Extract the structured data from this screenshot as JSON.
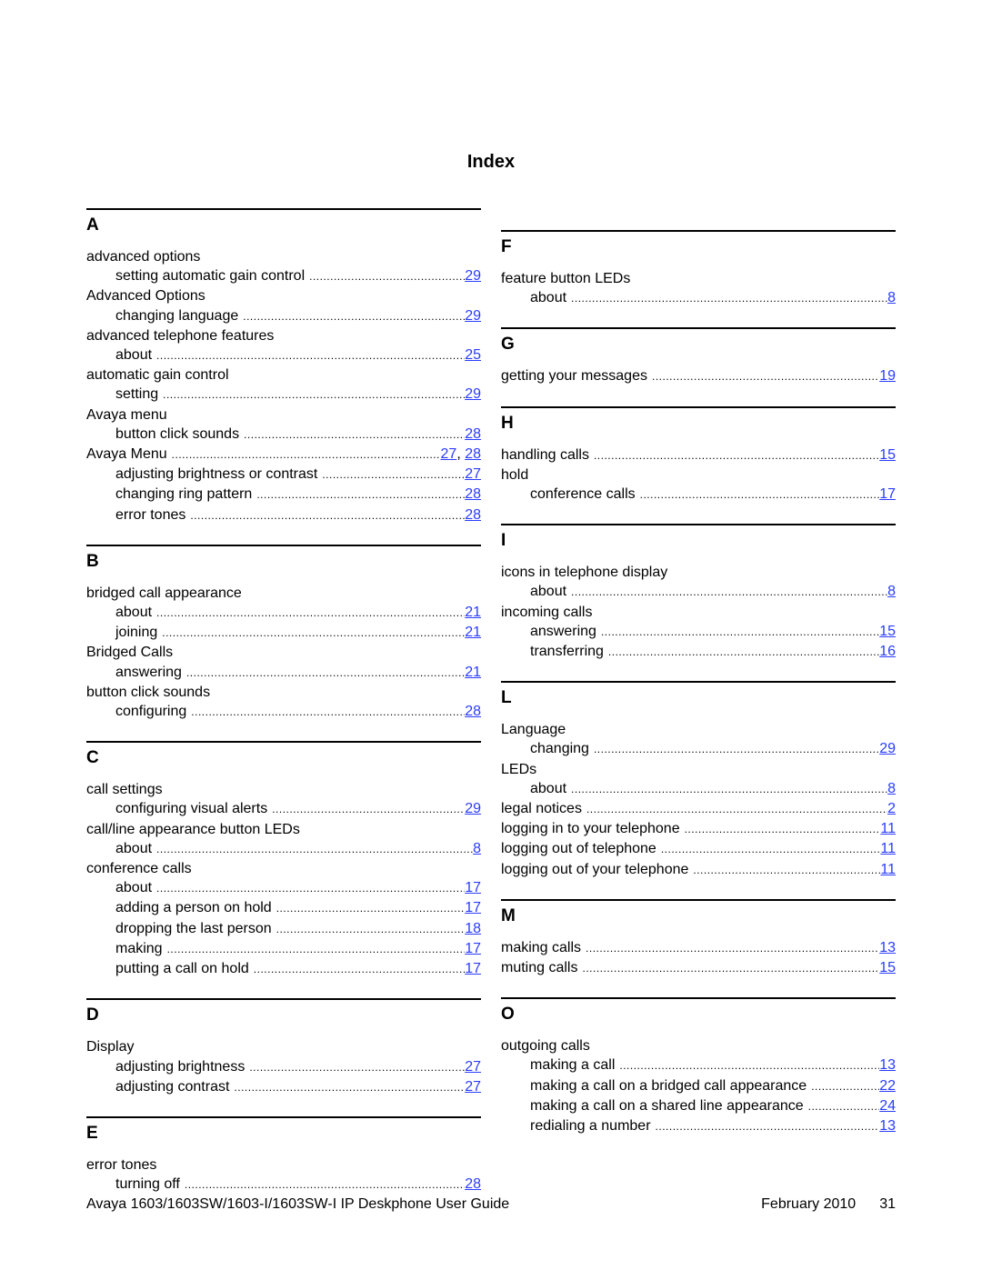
{
  "page_title": "Index",
  "columns": [
    [
      {
        "letter": "A",
        "entries": [
          {
            "term": "advanced options",
            "level": 0,
            "pages": []
          },
          {
            "term": "setting automatic gain control",
            "level": 1,
            "pages": [
              "29"
            ]
          },
          {
            "term": "Advanced Options",
            "level": 0,
            "pages": []
          },
          {
            "term": "changing language",
            "level": 1,
            "pages": [
              "29"
            ]
          },
          {
            "term": "advanced telephone features",
            "level": 0,
            "pages": []
          },
          {
            "term": "about",
            "level": 1,
            "pages": [
              "25"
            ]
          },
          {
            "term": "automatic gain control",
            "level": 0,
            "pages": []
          },
          {
            "term": "setting",
            "level": 1,
            "pages": [
              "29"
            ]
          },
          {
            "term": "Avaya menu",
            "level": 0,
            "pages": []
          },
          {
            "term": "button click sounds",
            "level": 1,
            "pages": [
              "28"
            ]
          },
          {
            "term": "Avaya Menu",
            "level": 0,
            "pages": [
              "27",
              "28"
            ]
          },
          {
            "term": "adjusting brightness or contrast",
            "level": 1,
            "pages": [
              "27"
            ]
          },
          {
            "term": "changing ring pattern",
            "level": 1,
            "pages": [
              "28"
            ]
          },
          {
            "term": "error tones",
            "level": 1,
            "pages": [
              "28"
            ]
          }
        ]
      },
      {
        "letter": "B",
        "entries": [
          {
            "term": "bridged call appearance",
            "level": 0,
            "pages": []
          },
          {
            "term": "about",
            "level": 1,
            "pages": [
              "21"
            ]
          },
          {
            "term": "joining",
            "level": 1,
            "pages": [
              "21"
            ]
          },
          {
            "term": "Bridged Calls",
            "level": 0,
            "pages": []
          },
          {
            "term": "answering",
            "level": 1,
            "pages": [
              "21"
            ]
          },
          {
            "term": "button click sounds",
            "level": 0,
            "pages": []
          },
          {
            "term": "configuring",
            "level": 1,
            "pages": [
              "28"
            ]
          }
        ]
      },
      {
        "letter": "C",
        "entries": [
          {
            "term": "call settings",
            "level": 0,
            "pages": []
          },
          {
            "term": "configuring visual alerts",
            "level": 1,
            "pages": [
              "29"
            ]
          },
          {
            "term": "call/line appearance button LEDs",
            "level": 0,
            "pages": []
          },
          {
            "term": "about",
            "level": 1,
            "pages": [
              "8"
            ]
          },
          {
            "term": "conference calls",
            "level": 0,
            "pages": []
          },
          {
            "term": "about",
            "level": 1,
            "pages": [
              "17"
            ]
          },
          {
            "term": "adding a person on hold",
            "level": 1,
            "pages": [
              "17"
            ]
          },
          {
            "term": "dropping the last person",
            "level": 1,
            "pages": [
              "18"
            ]
          },
          {
            "term": "making",
            "level": 1,
            "pages": [
              "17"
            ]
          },
          {
            "term": "putting a call on hold",
            "level": 1,
            "pages": [
              "17"
            ]
          }
        ]
      },
      {
        "letter": "D",
        "entries": [
          {
            "term": "Display",
            "level": 0,
            "pages": []
          },
          {
            "term": "adjusting brightness",
            "level": 1,
            "pages": [
              "27"
            ]
          },
          {
            "term": "adjusting contrast",
            "level": 1,
            "pages": [
              "27"
            ]
          }
        ]
      },
      {
        "letter": "E",
        "entries": [
          {
            "term": "error tones",
            "level": 0,
            "pages": []
          },
          {
            "term": "turning off",
            "level": 1,
            "pages": [
              "28"
            ]
          }
        ]
      }
    ],
    [
      {
        "letter": "F",
        "entries": [
          {
            "term": "feature button LEDs",
            "level": 0,
            "pages": []
          },
          {
            "term": "about",
            "level": 1,
            "pages": [
              "8"
            ]
          }
        ]
      },
      {
        "letter": "G",
        "entries": [
          {
            "term": "getting your messages",
            "level": 0,
            "pages": [
              "19"
            ]
          }
        ]
      },
      {
        "letter": "H",
        "entries": [
          {
            "term": "handling calls",
            "level": 0,
            "pages": [
              "15"
            ]
          },
          {
            "term": "hold",
            "level": 0,
            "pages": []
          },
          {
            "term": "conference calls",
            "level": 1,
            "pages": [
              "17"
            ]
          }
        ]
      },
      {
        "letter": "I",
        "entries": [
          {
            "term": "icons in telephone display",
            "level": 0,
            "pages": []
          },
          {
            "term": "about",
            "level": 1,
            "pages": [
              "8"
            ]
          },
          {
            "term": "incoming calls",
            "level": 0,
            "pages": []
          },
          {
            "term": "answering",
            "level": 1,
            "pages": [
              "15"
            ]
          },
          {
            "term": "transferring",
            "level": 1,
            "pages": [
              "16"
            ]
          }
        ]
      },
      {
        "letter": "L",
        "entries": [
          {
            "term": "Language",
            "level": 0,
            "pages": []
          },
          {
            "term": "changing",
            "level": 1,
            "pages": [
              "29"
            ]
          },
          {
            "term": "LEDs",
            "level": 0,
            "pages": []
          },
          {
            "term": "about",
            "level": 1,
            "pages": [
              "8"
            ]
          },
          {
            "term": "legal notices",
            "level": 0,
            "pages": [
              "2"
            ]
          },
          {
            "term": "logging in to your telephone",
            "level": 0,
            "pages": [
              "11"
            ]
          },
          {
            "term": "logging out of telephone",
            "level": 0,
            "pages": [
              "11"
            ]
          },
          {
            "term": "logging out of your telephone",
            "level": 0,
            "pages": [
              "11"
            ]
          }
        ]
      },
      {
        "letter": "M",
        "entries": [
          {
            "term": "making calls",
            "level": 0,
            "pages": [
              "13"
            ]
          },
          {
            "term": "muting calls",
            "level": 0,
            "pages": [
              "15"
            ]
          }
        ]
      },
      {
        "letter": "O",
        "entries": [
          {
            "term": "outgoing calls",
            "level": 0,
            "pages": []
          },
          {
            "term": "making a call",
            "level": 1,
            "pages": [
              "13"
            ]
          },
          {
            "term": "making a call on a bridged call appearance",
            "level": 1,
            "pages": [
              "22"
            ]
          },
          {
            "term": "making a call on a shared line appearance",
            "level": 1,
            "pages": [
              "24"
            ]
          },
          {
            "term": "redialing a number",
            "level": 1,
            "pages": [
              "13"
            ]
          }
        ]
      }
    ]
  ],
  "footer": {
    "guide_title": "Avaya 1603/1603SW/1603-I/1603SW-I IP Deskphone User Guide",
    "date": "February 2010",
    "page_number": "31"
  },
  "colors": {
    "link": "#2a3cff",
    "text": "#000000"
  }
}
